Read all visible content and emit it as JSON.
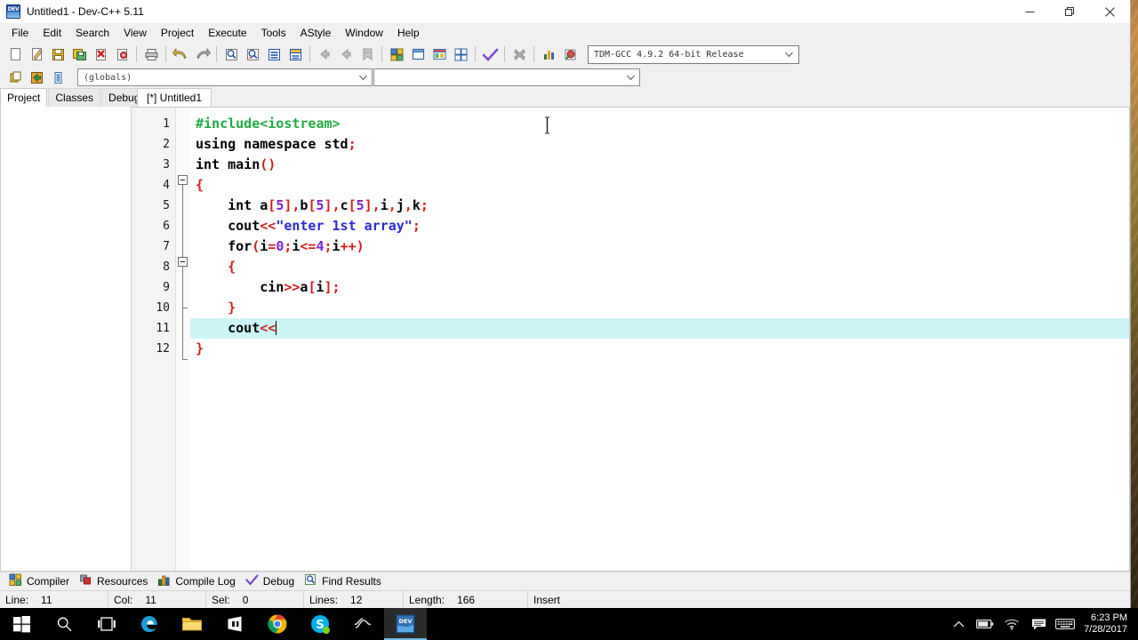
{
  "window": {
    "title": "Untitled1 - Dev-C++ 5.11",
    "app_icon": "devcpp-icon",
    "controls": {
      "minimize": "minimize-button",
      "restore": "restore-button",
      "close": "close-button"
    }
  },
  "menu": {
    "items": [
      "File",
      "Edit",
      "Search",
      "View",
      "Project",
      "Execute",
      "Tools",
      "AStyle",
      "Window",
      "Help"
    ]
  },
  "toolbar": {
    "groups": [
      {
        "name": "file",
        "buttons": [
          "new-file-icon",
          "open-file-icon",
          "save-icon",
          "save-all-icon",
          "close-file-icon",
          "print-setup-icon"
        ]
      },
      {
        "name": "print",
        "buttons": [
          "print-icon"
        ]
      },
      {
        "name": "undo",
        "buttons": [
          "undo-icon",
          "redo-icon"
        ]
      },
      {
        "name": "find",
        "buttons": [
          "find-icon",
          "replace-icon",
          "goto-line-icon",
          "goto-function-icon"
        ]
      },
      {
        "name": "navigate",
        "buttons": [
          "back-icon",
          "forward-icon",
          "bookmark-icon"
        ]
      },
      {
        "name": "project",
        "buttons": [
          "new-project-icon",
          "new-form-icon",
          "project-options-icon",
          "project-manager-icon"
        ]
      },
      {
        "name": "compile",
        "buttons": [
          "compile-icon"
        ]
      },
      {
        "name": "stop",
        "buttons": [
          "stop-execution-icon"
        ]
      },
      {
        "name": "run",
        "buttons": [
          "run-icon",
          "compile-and-run-icon"
        ]
      }
    ],
    "compiler_select": {
      "value": "TDM-GCC 4.9.2 64-bit Release",
      "icon": "chevron-down-icon"
    }
  },
  "toolbar2": {
    "buttons": [
      "insert-icon",
      "toggle-icon",
      "goto-class-icon"
    ],
    "scope_select": {
      "value": "(globals)",
      "icon": "chevron-down-icon"
    },
    "member_select": {
      "value": "",
      "icon": "chevron-down-icon"
    }
  },
  "panel_tabs": [
    {
      "label": "Project",
      "active": true
    },
    {
      "label": "Classes",
      "active": false
    },
    {
      "label": "Debug",
      "active": false
    }
  ],
  "editor_tabs": [
    {
      "label": "[*] Untitled1",
      "active": true
    }
  ],
  "editor": {
    "line_numbers": [
      "1",
      "2",
      "3",
      "4",
      "5",
      "6",
      "7",
      "8",
      "9",
      "10",
      "11",
      "12"
    ],
    "highlight_line": 11,
    "fold_markers": [
      {
        "line": 4,
        "type": "collapse-box"
      },
      {
        "line": 8,
        "type": "collapse-box"
      }
    ],
    "lines": [
      {
        "n": 1,
        "tokens": [
          {
            "t": "#include<iostream>",
            "c": "pre"
          }
        ]
      },
      {
        "n": 2,
        "tokens": [
          {
            "t": "using namespace std",
            "c": "plain"
          },
          {
            "t": ";",
            "c": "sym"
          }
        ]
      },
      {
        "n": 3,
        "tokens": [
          {
            "t": "int main",
            "c": "plain"
          },
          {
            "t": "()",
            "c": "sym"
          }
        ]
      },
      {
        "n": 4,
        "tokens": [
          {
            "t": "{",
            "c": "brace"
          }
        ]
      },
      {
        "n": 5,
        "tokens": [
          {
            "t": "    int a",
            "c": "plain"
          },
          {
            "t": "[",
            "c": "sym"
          },
          {
            "t": "5",
            "c": "num"
          },
          {
            "t": "]",
            "c": "sym"
          },
          {
            "t": ",",
            "c": "sym"
          },
          {
            "t": "b",
            "c": "plain"
          },
          {
            "t": "[",
            "c": "sym"
          },
          {
            "t": "5",
            "c": "num"
          },
          {
            "t": "]",
            "c": "sym"
          },
          {
            "t": ",",
            "c": "sym"
          },
          {
            "t": "c",
            "c": "plain"
          },
          {
            "t": "[",
            "c": "sym"
          },
          {
            "t": "5",
            "c": "num"
          },
          {
            "t": "]",
            "c": "sym"
          },
          {
            "t": ",",
            "c": "sym"
          },
          {
            "t": "i",
            "c": "plain"
          },
          {
            "t": ",",
            "c": "sym"
          },
          {
            "t": "j",
            "c": "plain"
          },
          {
            "t": ",",
            "c": "sym"
          },
          {
            "t": "k",
            "c": "plain"
          },
          {
            "t": ";",
            "c": "sym"
          }
        ]
      },
      {
        "n": 6,
        "tokens": [
          {
            "t": "    cout",
            "c": "plain"
          },
          {
            "t": "<<",
            "c": "sym"
          },
          {
            "t": "\"enter 1st array\"",
            "c": "str"
          },
          {
            "t": ";",
            "c": "sym"
          }
        ]
      },
      {
        "n": 7,
        "tokens": [
          {
            "t": "    for",
            "c": "plain"
          },
          {
            "t": "(",
            "c": "sym"
          },
          {
            "t": "i",
            "c": "plain"
          },
          {
            "t": "=",
            "c": "sym"
          },
          {
            "t": "0",
            "c": "num"
          },
          {
            "t": ";",
            "c": "sym"
          },
          {
            "t": "i",
            "c": "plain"
          },
          {
            "t": "<=",
            "c": "sym"
          },
          {
            "t": "4",
            "c": "num"
          },
          {
            "t": ";",
            "c": "sym"
          },
          {
            "t": "i",
            "c": "plain"
          },
          {
            "t": "++",
            "c": "sym"
          },
          {
            "t": ")",
            "c": "sym"
          }
        ]
      },
      {
        "n": 8,
        "tokens": [
          {
            "t": "    ",
            "c": "plain"
          },
          {
            "t": "{",
            "c": "brace"
          }
        ]
      },
      {
        "n": 9,
        "tokens": [
          {
            "t": "        cin",
            "c": "plain"
          },
          {
            "t": ">>",
            "c": "sym"
          },
          {
            "t": "a",
            "c": "plain"
          },
          {
            "t": "[",
            "c": "sym"
          },
          {
            "t": "i",
            "c": "plain"
          },
          {
            "t": "]",
            "c": "sym"
          },
          {
            "t": ";",
            "c": "sym"
          }
        ]
      },
      {
        "n": 10,
        "tokens": [
          {
            "t": "    ",
            "c": "plain"
          },
          {
            "t": "}",
            "c": "brace"
          }
        ]
      },
      {
        "n": 11,
        "tokens": [
          {
            "t": "    cout",
            "c": "plain"
          },
          {
            "t": "<<",
            "c": "sym"
          }
        ],
        "caret": true
      },
      {
        "n": 12,
        "tokens": [
          {
            "t": "}",
            "c": "brace"
          }
        ]
      }
    ],
    "mouse_cursor": "i-beam-cursor"
  },
  "bottom_tabs": [
    {
      "label": "Compiler",
      "icon": "compiler-icon"
    },
    {
      "label": "Resources",
      "icon": "resources-icon"
    },
    {
      "label": "Compile Log",
      "icon": "compile-log-icon"
    },
    {
      "label": "Debug",
      "icon": "debug-check-icon"
    },
    {
      "label": "Find Results",
      "icon": "find-results-icon"
    }
  ],
  "status_bar": {
    "line_label": "Line:",
    "line_value": "11",
    "col_label": "Col:",
    "col_value": "11",
    "sel_label": "Sel:",
    "sel_value": "0",
    "lines_label": "Lines:",
    "lines_value": "12",
    "length_label": "Length:",
    "length_value": "166",
    "mode": "Insert"
  },
  "taskbar": {
    "items": [
      {
        "name": "start-button",
        "icon": "windows-logo-icon"
      },
      {
        "name": "search-button",
        "icon": "search-icon"
      },
      {
        "name": "task-view-button",
        "icon": "task-view-icon"
      },
      {
        "name": "edge-button",
        "icon": "edge-icon"
      },
      {
        "name": "file-explorer-button",
        "icon": "folder-icon"
      },
      {
        "name": "store-button",
        "icon": "store-icon"
      },
      {
        "name": "chrome-button",
        "icon": "chrome-icon"
      },
      {
        "name": "skype-button",
        "icon": "skype-icon"
      },
      {
        "name": "sfit-button",
        "icon": "swirl-icon"
      },
      {
        "name": "devcpp-button",
        "icon": "devcpp-icon",
        "active": true
      }
    ],
    "tray": [
      {
        "name": "show-hidden-icons",
        "icon": "chevron-up-icon"
      },
      {
        "name": "battery-status",
        "icon": "battery-icon"
      },
      {
        "name": "network-status",
        "icon": "wifi-icon"
      },
      {
        "name": "action-center",
        "icon": "notification-icon"
      },
      {
        "name": "touch-keyboard",
        "icon": "keyboard-icon"
      }
    ],
    "clock": {
      "time": "6:23 PM",
      "date": "7/28/2017"
    }
  },
  "colors": {
    "window_bg": "#f0f0f0",
    "editor_bg": "#ffffff",
    "highlight_line": "#ccf5f5",
    "preprocessor": "#22aa44",
    "string": "#2a2ad0",
    "number": "#7a22cc",
    "symbol": "#d02020",
    "taskbar_bg": "#000000",
    "accent": "#6fbbe8"
  }
}
